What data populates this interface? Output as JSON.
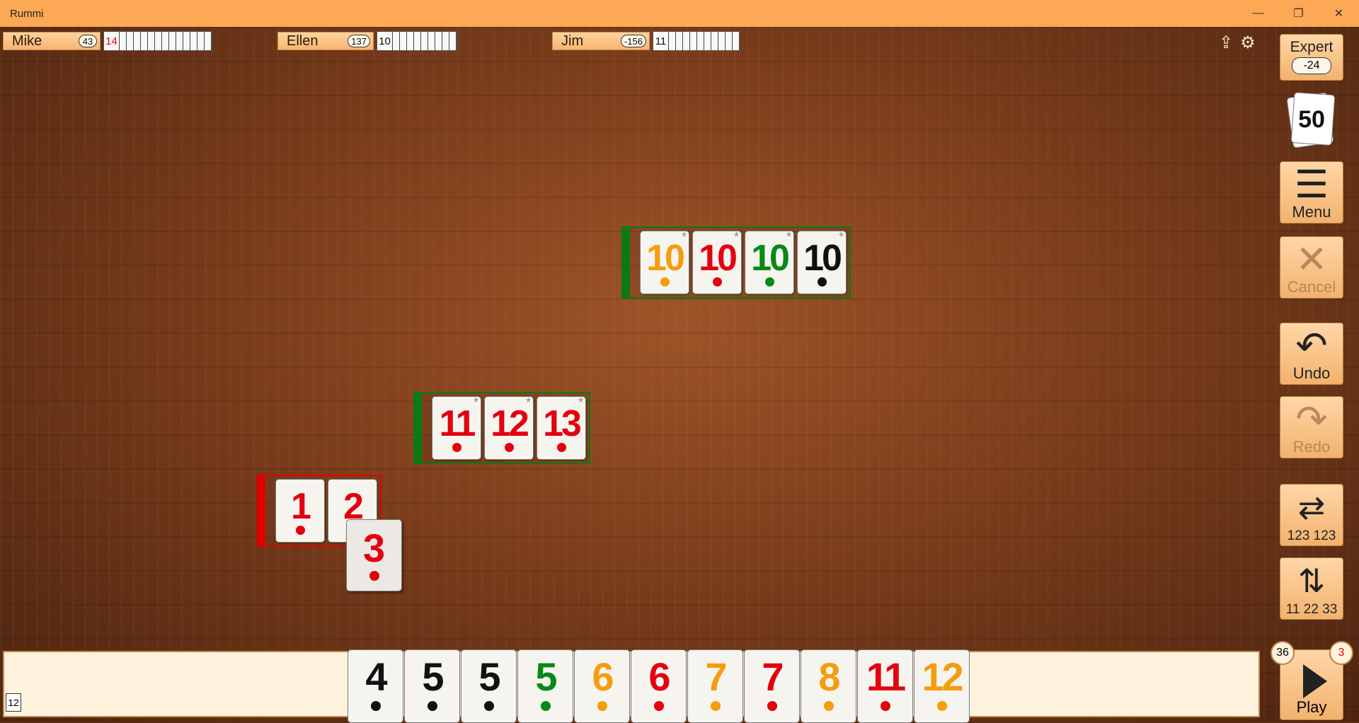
{
  "window": {
    "title": "Rummi",
    "controls": [
      "—",
      "❐",
      "✕"
    ]
  },
  "players": [
    {
      "name": "Mike",
      "score": "43",
      "tiles": "14",
      "highlight": true
    },
    {
      "name": "Ellen",
      "score": "137",
      "tiles": "10",
      "highlight": false
    },
    {
      "name": "Jim",
      "score": "-156",
      "tiles": "11",
      "highlight": false
    }
  ],
  "top_icons": {
    "share": "share-icon",
    "settings": "gear-icon"
  },
  "level": {
    "label": "Expert",
    "value": "-24"
  },
  "pool": {
    "count": "50"
  },
  "side_buttons": {
    "menu": "Menu",
    "cancel": "Cancel",
    "undo": "Undo",
    "redo": "Redo",
    "sort_run": "123 123",
    "sort_group": "11 22 33"
  },
  "board": {
    "group_tens": [
      {
        "n": "10",
        "color": "orange"
      },
      {
        "n": "10",
        "color": "red"
      },
      {
        "n": "10",
        "color": "green"
      },
      {
        "n": "10",
        "color": "black"
      }
    ],
    "run_red_high": [
      {
        "n": "11",
        "color": "red"
      },
      {
        "n": "12",
        "color": "red"
      },
      {
        "n": "13",
        "color": "red"
      }
    ],
    "run_red_low": [
      {
        "n": "1",
        "color": "red"
      },
      {
        "n": "2",
        "color": "red"
      }
    ],
    "dragged_tile": {
      "n": "3",
      "color": "red"
    }
  },
  "rack": {
    "count": "12",
    "tiles": [
      {
        "n": "4",
        "color": "black"
      },
      {
        "n": "5",
        "color": "black"
      },
      {
        "n": "5",
        "color": "black"
      },
      {
        "n": "5",
        "color": "green"
      },
      {
        "n": "6",
        "color": "orange"
      },
      {
        "n": "6",
        "color": "red"
      },
      {
        "n": "7",
        "color": "orange"
      },
      {
        "n": "7",
        "color": "red"
      },
      {
        "n": "8",
        "color": "orange"
      },
      {
        "n": "11",
        "color": "red"
      },
      {
        "n": "12",
        "color": "orange"
      }
    ]
  },
  "play": {
    "label": "Play",
    "left_badge": "36",
    "right_badge": "3"
  },
  "colors": {
    "red": "#e3000f",
    "orange": "#f59d0e",
    "green": "#078a17",
    "black": "#111111",
    "accent": "#fda855"
  }
}
